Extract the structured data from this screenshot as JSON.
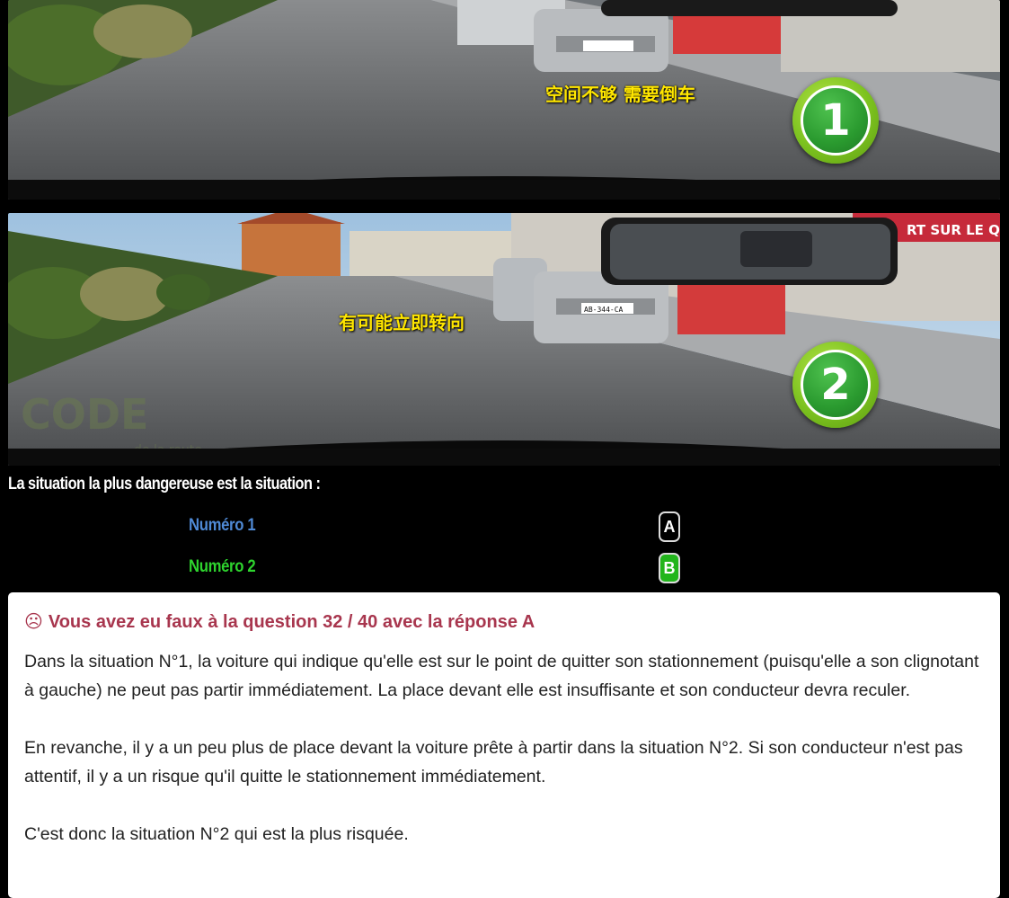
{
  "scenes": [
    {
      "overlay_text": "空间不够 需要倒车",
      "badge": "1"
    },
    {
      "overlay_text": "有可能立即转向",
      "badge": "2"
    }
  ],
  "signage": {
    "shop_sign": "RT SUR LE QUAI",
    "plate": "AB-344-CA",
    "watermark": "CODE",
    "watermark_sub": "de la route"
  },
  "question": {
    "text": "La situation la plus dangereuse est la situation :"
  },
  "answers": [
    {
      "label": "Numéro 1",
      "key": "A",
      "color": "#4f8ad6"
    },
    {
      "label": "Numéro 2",
      "key": "B",
      "color": "#2ed42e"
    }
  ],
  "result": {
    "icon": "sad-face-icon",
    "glyph": "☹",
    "title": "Vous avez eu faux à la question 32 / 40 avec la réponse A",
    "paragraphs": [
      "Dans la situation N°1, la voiture qui indique qu'elle est sur le point de quitter son stationnement (puisqu'elle a son clignotant à gauche) ne peut pas partir immédiatement. La place devant elle est insuffisante et son conducteur devra reculer.",
      "En revanche, il y a un peu plus de place devant la voiture prête à partir dans la situation N°2. Si son conducteur n'est pas attentif, il y a un risque qu'il quitte le stationnement immédiatement.",
      "C'est donc la situation N°2 qui est la plus risquée."
    ]
  }
}
